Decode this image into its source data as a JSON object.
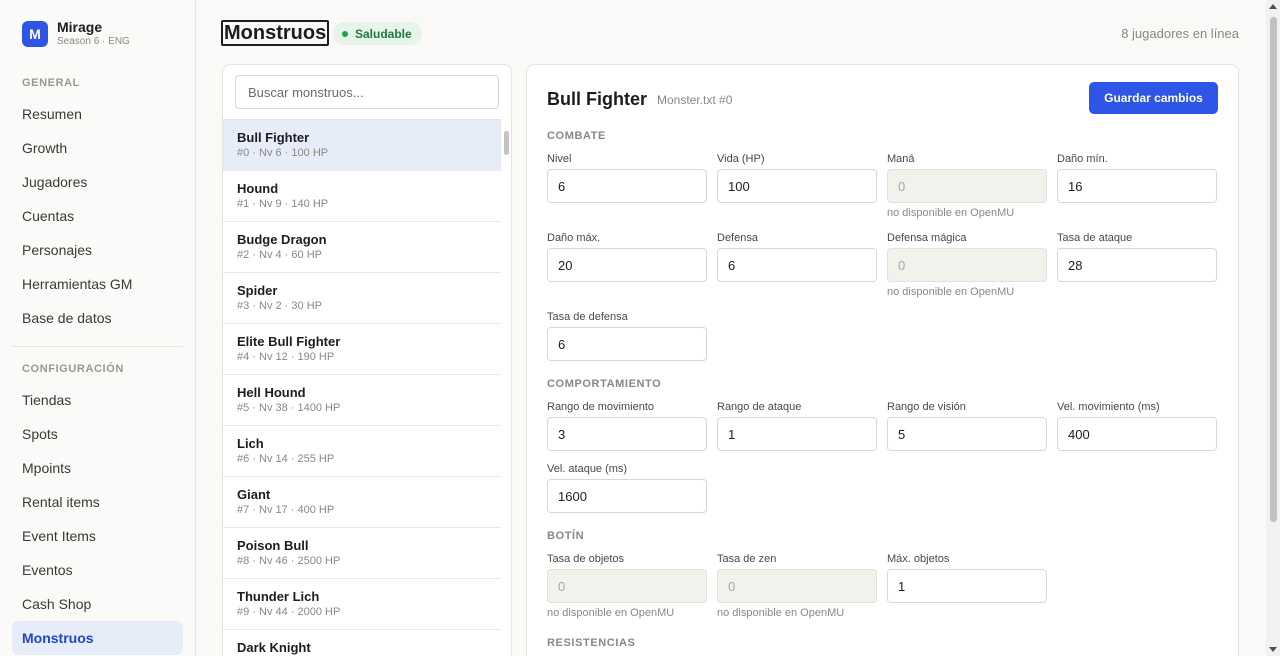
{
  "brand": {
    "logo_letter": "M",
    "name": "Mirage",
    "subtitle": "Season 6 · ENG"
  },
  "sidebar": {
    "section_general": "GENERAL",
    "general_items": [
      {
        "label": "Resumen"
      },
      {
        "label": "Growth"
      },
      {
        "label": "Jugadores"
      },
      {
        "label": "Cuentas"
      },
      {
        "label": "Personajes"
      },
      {
        "label": "Herramientas GM"
      },
      {
        "label": "Base de datos"
      }
    ],
    "section_config": "CONFIGURACIÓN",
    "config_items": [
      {
        "label": "Tiendas"
      },
      {
        "label": "Spots"
      },
      {
        "label": "Mpoints"
      },
      {
        "label": "Rental items"
      },
      {
        "label": "Event Items"
      },
      {
        "label": "Eventos"
      },
      {
        "label": "Cash Shop"
      },
      {
        "label": "Monstruos",
        "active": true
      }
    ]
  },
  "header": {
    "title": "Monstruos",
    "status": "Saludable",
    "online": "8 jugadores en línea"
  },
  "search": {
    "placeholder": "Buscar monstruos..."
  },
  "monsters": [
    {
      "name": "Bull Fighter",
      "meta": "#0 · Nv 6 · 100 HP",
      "selected": true
    },
    {
      "name": "Hound",
      "meta": "#1 · Nv 9 · 140 HP"
    },
    {
      "name": "Budge Dragon",
      "meta": "#2 · Nv 4 · 60 HP"
    },
    {
      "name": "Spider",
      "meta": "#3 · Nv 2 · 30 HP"
    },
    {
      "name": "Elite Bull Fighter",
      "meta": "#4 · Nv 12 · 190 HP"
    },
    {
      "name": "Hell Hound",
      "meta": "#5 · Nv 38 · 1400 HP"
    },
    {
      "name": "Lich",
      "meta": "#6 · Nv 14 · 255 HP"
    },
    {
      "name": "Giant",
      "meta": "#7 · Nv 17 · 400 HP"
    },
    {
      "name": "Poison Bull",
      "meta": "#8 · Nv 46 · 2500 HP"
    },
    {
      "name": "Thunder Lich",
      "meta": "#9 · Nv 44 · 2000 HP"
    },
    {
      "name": "Dark Knight",
      "meta": ""
    }
  ],
  "detail": {
    "title": "Bull Fighter",
    "subtitle": "Monster.txt #0",
    "save_label": "Guardar cambios",
    "sections": {
      "combat": "COMBATE",
      "behavior": "COMPORTAMIENTO",
      "loot": "BOTÍN",
      "resist": "RESISTENCIAS"
    },
    "unavailable_note": "no disponible en OpenMU",
    "fields": {
      "level": {
        "label": "Nivel",
        "value": "6"
      },
      "hp": {
        "label": "Vida (HP)",
        "value": "100"
      },
      "mana": {
        "label": "Maná",
        "value": "0"
      },
      "dmg_min": {
        "label": "Daño mín.",
        "value": "16"
      },
      "dmg_max": {
        "label": "Daño máx.",
        "value": "20"
      },
      "defense": {
        "label": "Defensa",
        "value": "6"
      },
      "magic_def": {
        "label": "Defensa mágica",
        "value": "0"
      },
      "atk_rate": {
        "label": "Tasa de ataque",
        "value": "28"
      },
      "def_rate": {
        "label": "Tasa de defensa",
        "value": "6"
      },
      "move_range": {
        "label": "Rango de movimiento",
        "value": "3"
      },
      "atk_range": {
        "label": "Rango de ataque",
        "value": "1"
      },
      "view_range": {
        "label": "Rango de visión",
        "value": "5"
      },
      "move_speed": {
        "label": "Vel. movimiento (ms)",
        "value": "400"
      },
      "atk_speed": {
        "label": "Vel. ataque (ms)",
        "value": "1600"
      },
      "item_rate": {
        "label": "Tasa de objetos",
        "value": "0"
      },
      "zen_rate": {
        "label": "Tasa de zen",
        "value": "0"
      },
      "max_items": {
        "label": "Máx. objetos",
        "value": "1"
      }
    }
  }
}
